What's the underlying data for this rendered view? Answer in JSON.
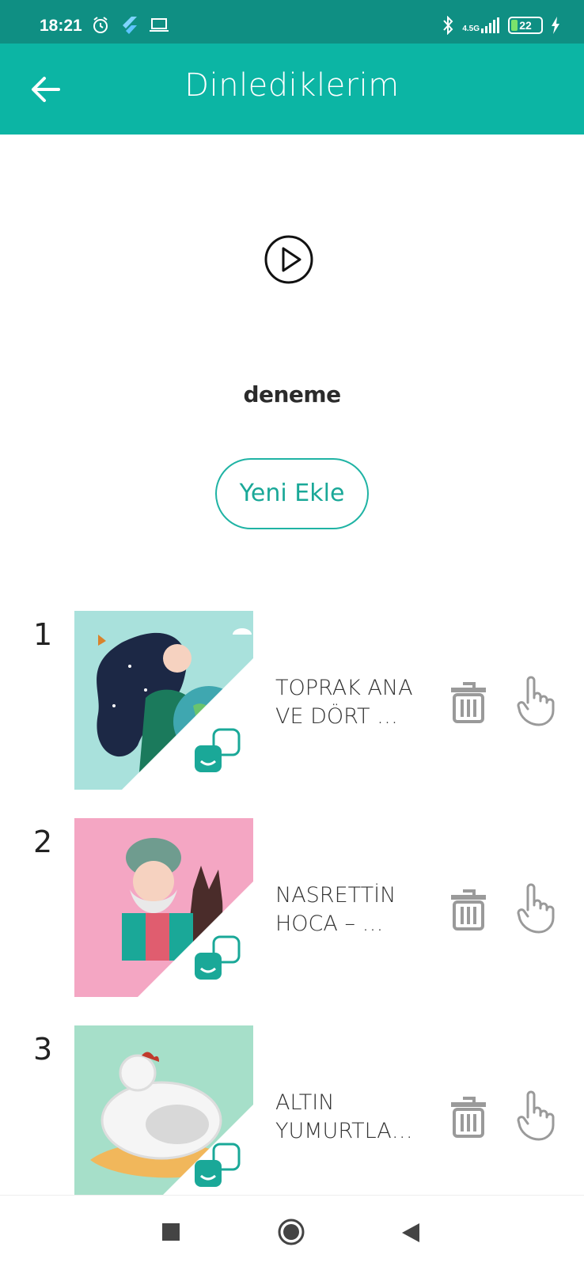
{
  "status_bar": {
    "time": "18:21",
    "network": "4.5G",
    "battery": "22",
    "icons": [
      "alarm-icon",
      "flutter-icon",
      "laptop-icon",
      "bluetooth-icon",
      "signal-icon",
      "battery-icon",
      "charging-icon"
    ]
  },
  "header": {
    "title": "Dinlediklerim",
    "back_icon": "arrow-left-icon"
  },
  "player": {
    "play_icon": "play-circle-icon",
    "track_name": "deneme",
    "add_button_label": "Yeni Ekle"
  },
  "list": {
    "items": [
      {
        "index": "1",
        "title": "TOPRAK ANA\nVE DÖRT …",
        "thumb_bg": "#a9e1dc"
      },
      {
        "index": "2",
        "title": "NASRETTİN\nHOCA – …",
        "thumb_bg": "#f4a6c3"
      },
      {
        "index": "3",
        "title": "ALTIN\nYUMURTLA…",
        "thumb_bg": "#a6dfc9"
      }
    ],
    "action_icons": [
      "trash-icon",
      "hand-pointer-icon"
    ]
  },
  "nav": {
    "icons": [
      "recent-apps-icon",
      "home-icon",
      "back-icon"
    ]
  },
  "colors": {
    "status_bar": "#0f8f83",
    "app_bar": "#0cb5a4",
    "accent": "#1fb3a4",
    "icon_gray": "#9a9a9a"
  }
}
